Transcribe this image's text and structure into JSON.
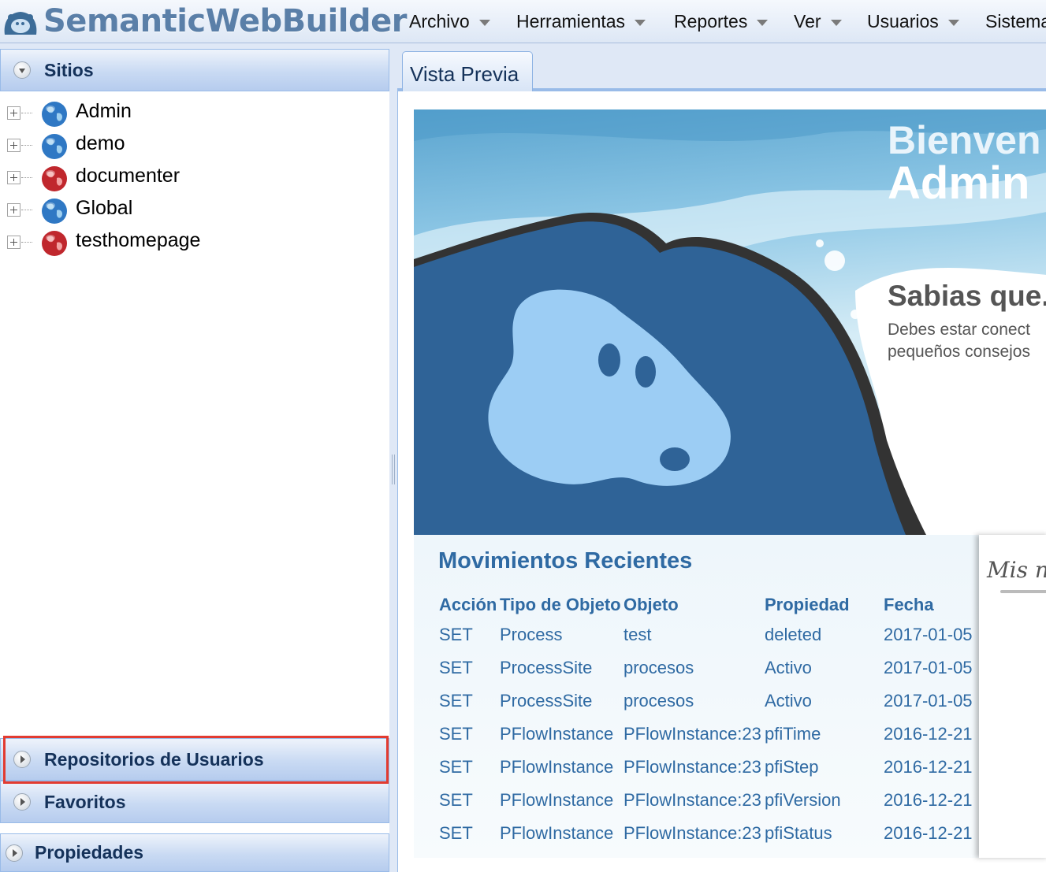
{
  "app": {
    "title": "SemanticWebBuilder"
  },
  "menu": {
    "items": [
      {
        "label": "Archivo"
      },
      {
        "label": "Herramientas"
      },
      {
        "label": "Reportes"
      },
      {
        "label": "Ver"
      },
      {
        "label": "Usuarios"
      },
      {
        "label": "Sistema"
      }
    ]
  },
  "left_panel": {
    "sitios": {
      "title": "Sitios",
      "items": [
        {
          "label": "Admin",
          "icon": "globe-blue-icon"
        },
        {
          "label": "demo",
          "icon": "globe-blue-icon"
        },
        {
          "label": "documenter",
          "icon": "globe-red-icon"
        },
        {
          "label": "Global",
          "icon": "globe-blue-icon"
        },
        {
          "label": "testhomepage",
          "icon": "globe-red-icon"
        }
      ]
    },
    "repositorios": {
      "title": "Repositorios de Usuarios"
    },
    "favoritos": {
      "title": "Favoritos"
    },
    "propiedades": {
      "title": "Propiedades"
    }
  },
  "tabs": [
    {
      "label": "Vista Previa"
    }
  ],
  "preview": {
    "welcome": "Bienven",
    "user": "Admin",
    "tip_title": "Sabias que.",
    "tip_line1": "Debes estar conect",
    "tip_line2": "pequeños consejos",
    "recent": {
      "title": "Movimientos Recientes",
      "columns": [
        "Acción",
        "Tipo de Objeto",
        "Objeto",
        "Propiedad",
        "Fecha"
      ],
      "rows": [
        [
          "SET",
          "Process",
          "test",
          "deleted",
          "2017-01-05"
        ],
        [
          "SET",
          "ProcessSite",
          "procesos",
          "Activo",
          "2017-01-05"
        ],
        [
          "SET",
          "ProcessSite",
          "procesos",
          "Activo",
          "2017-01-05"
        ],
        [
          "SET",
          "PFlowInstance",
          "PFlowInstance:23",
          "pfiTime",
          "2016-12-21"
        ],
        [
          "SET",
          "PFlowInstance",
          "PFlowInstance:23",
          "pfiStep",
          "2016-12-21"
        ],
        [
          "SET",
          "PFlowInstance",
          "PFlowInstance:23",
          "pfiVersion",
          "2016-12-21"
        ],
        [
          "SET",
          "PFlowInstance",
          "PFlowInstance:23",
          "pfiStatus",
          "2016-12-21"
        ]
      ]
    },
    "note": "Mis n"
  },
  "colors": {
    "accent": "#2f6aa3",
    "header_text": "#15325a",
    "highlight": "#e23b30"
  }
}
